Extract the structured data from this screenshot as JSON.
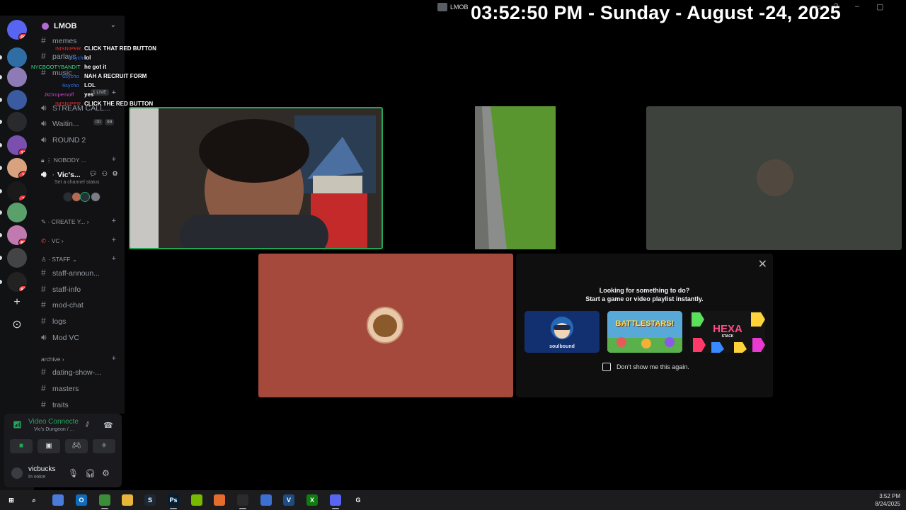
{
  "window": {
    "title": "LMOB",
    "overlay_clock": "03:52:50 PM - Sunday - August -24, 2025"
  },
  "server_rail": {
    "servers": [
      {
        "name": "discord-home",
        "badge": "99",
        "color": "#5865f2"
      },
      {
        "name": "better-days-ahead",
        "badge": "",
        "color": "#2f6ea5"
      },
      {
        "name": "masked-server",
        "badge": "",
        "color": "#8e7bb5"
      },
      {
        "name": "gamer-server",
        "badge": "",
        "color": "#3a5ba0"
      },
      {
        "name": "white-v-server",
        "badge": "",
        "color": "#2a2a2e"
      },
      {
        "name": "cat-server",
        "badge": "12",
        "color": "#7a4fb0"
      },
      {
        "name": "girl-server",
        "badge": "3",
        "color": "#d8a27f"
      },
      {
        "name": "stream-server",
        "badge": "2",
        "color": "#1a1a1a"
      },
      {
        "name": "scenery-server",
        "badge": "",
        "color": "#5aa06a"
      },
      {
        "name": "anime-server",
        "badge": "69",
        "color": "#c17ab0"
      },
      {
        "name": "lmob-server",
        "badge": "",
        "color": "#444"
      },
      {
        "name": "nss-server",
        "badge": "87",
        "color": "#222"
      }
    ],
    "add_label": "+",
    "discover_label": "⊙"
  },
  "guild": {
    "name": "LMOB",
    "channels": [
      {
        "type": "text",
        "label": "memes"
      },
      {
        "type": "text",
        "label": "parlays"
      },
      {
        "type": "text",
        "label": "music"
      },
      {
        "type": "text",
        "label": "1 LIVE"
      },
      {
        "type": "voice",
        "label": "STREAM CALL..."
      },
      {
        "type": "voice",
        "label": "Waitin...",
        "counter_a": "00",
        "counter_b": "99"
      },
      {
        "type": "voice",
        "label": "ROUND 2"
      }
    ],
    "nobody_category": "NOBODY ...",
    "active_voice": "Vic's...",
    "channel_status_placeholder": "Set a channel status",
    "create_category": "CREATE Y...",
    "vc_category": "VC",
    "staff_category": "STAFF",
    "staff_channels": [
      {
        "type": "text",
        "label": "staff-announ..."
      },
      {
        "type": "text",
        "label": "staff-info"
      },
      {
        "type": "text",
        "label": "mod-chat"
      },
      {
        "type": "text",
        "label": "logs"
      },
      {
        "type": "voice",
        "label": "Mod VC"
      }
    ],
    "archive_category": "archive",
    "archive_channels": [
      {
        "type": "text",
        "label": "dating-show-..."
      },
      {
        "type": "text",
        "label": "masters"
      },
      {
        "type": "text",
        "label": "traits"
      }
    ]
  },
  "chat_overlay": [
    {
      "user": "IMSNIPER",
      "user_color": "#e03a3a",
      "message": "CLICK THAT RED BUTTON"
    },
    {
      "user": "6sycho",
      "user_color": "#3b7dff",
      "message": "lol"
    },
    {
      "user": "NYCBOOTYBANDIT",
      "user_color": "#3ee08f",
      "message": "he got it"
    },
    {
      "user": "6sycho",
      "user_color": "#3b7dff",
      "message": "NAH A RECRUIT FORM"
    },
    {
      "user": "6sycho",
      "user_color": "#3b7dff",
      "message": "LOL"
    },
    {
      "user": "JkDropemoff",
      "user_color": "#d04ad0",
      "message": "yes"
    },
    {
      "user": "IMSNIPER",
      "user_color": "#e03a3a",
      "message": "CLICK THE RED BUTTON"
    }
  ],
  "voice_panel": {
    "status": "Video Connecte",
    "location": "Vic's Dungeon / ...",
    "user_name": "vicbucks",
    "user_status": "In voice"
  },
  "activity_popup": {
    "title": "Looking for something to do?",
    "subtitle": "Start a game or video playlist instantly.",
    "games": [
      "soulbound",
      "BATTLESTARS!",
      "HEXA"
    ],
    "hexa_sub": "STACK",
    "dont_show": "Don't show me this again."
  },
  "taskbar": {
    "time": "3:52 PM",
    "date": "8/24/2025",
    "apps": [
      {
        "name": "windows-start",
        "label": "⊞",
        "color": "#1c1c1e"
      },
      {
        "name": "search",
        "label": "⌕",
        "color": "#1c1c1e"
      },
      {
        "name": "copilot",
        "label": "",
        "color": "#4a7bd8"
      },
      {
        "name": "outlook",
        "label": "O",
        "color": "#0f6cbd"
      },
      {
        "name": "chrome",
        "label": "",
        "color": "#3c8d3a"
      },
      {
        "name": "file-explorer",
        "label": "",
        "color": "#e8b43a"
      },
      {
        "name": "steam",
        "label": "S",
        "color": "#1b2838"
      },
      {
        "name": "photoshop",
        "label": "Ps",
        "color": "#001e36"
      },
      {
        "name": "nvidia",
        "label": "",
        "color": "#76b900"
      },
      {
        "name": "firefox",
        "label": "",
        "color": "#e46d2d"
      },
      {
        "name": "obs",
        "label": "",
        "color": "#2b2b2b"
      },
      {
        "name": "store",
        "label": "",
        "color": "#3c6fd0"
      },
      {
        "name": "vegas",
        "label": "V",
        "color": "#1d4c80"
      },
      {
        "name": "xbox",
        "label": "X",
        "color": "#107c10"
      },
      {
        "name": "discord",
        "label": "",
        "color": "#5865f2"
      },
      {
        "name": "logitech",
        "label": "G",
        "color": "#1c1c1e"
      }
    ]
  }
}
